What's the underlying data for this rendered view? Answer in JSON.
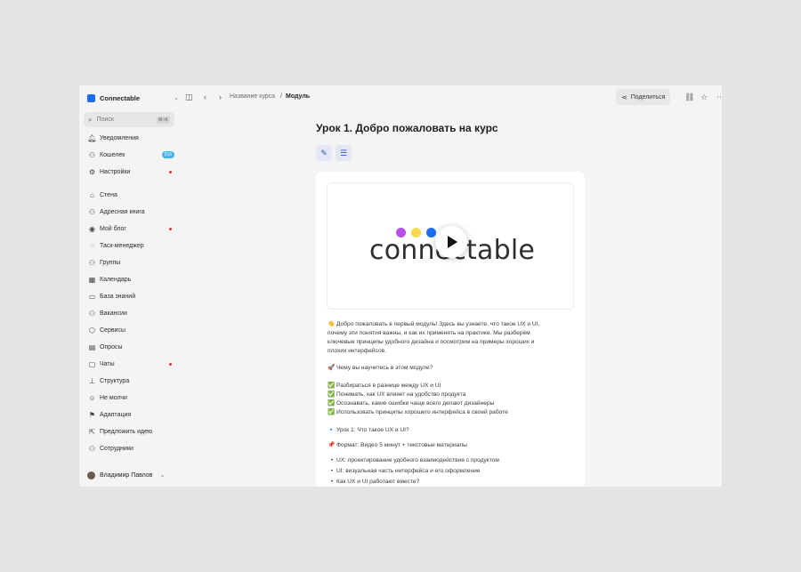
{
  "workspace": {
    "name": "Connectable"
  },
  "search": {
    "placeholder": "Поиск",
    "shortcut": "⌘+K"
  },
  "sidebar": {
    "top": [
      {
        "label": "Уведомления",
        "icon": "bell-icon"
      },
      {
        "label": "Кошелек",
        "icon": "wallet-icon",
        "badge": "516"
      },
      {
        "label": "Настройки",
        "icon": "gear-icon",
        "dot": true
      }
    ],
    "items": [
      {
        "label": "Стена",
        "icon": "home-icon"
      },
      {
        "label": "Адресная книга",
        "icon": "contacts-icon"
      },
      {
        "label": "Мой блог",
        "icon": "blog-icon",
        "dot": true
      },
      {
        "label": "Таск-менеджер",
        "icon": "check-circle-icon"
      },
      {
        "label": "Группы",
        "icon": "groups-icon"
      },
      {
        "label": "Календарь",
        "icon": "calendar-icon"
      },
      {
        "label": "База знаний",
        "icon": "folder-icon"
      },
      {
        "label": "Вакансии",
        "icon": "vacancies-icon"
      },
      {
        "label": "Сервисы",
        "icon": "services-icon"
      },
      {
        "label": "Опросы",
        "icon": "polls-icon"
      },
      {
        "label": "Чаты",
        "icon": "chat-icon",
        "dot": true
      },
      {
        "label": "Структура",
        "icon": "structure-icon"
      },
      {
        "label": "Не молчи",
        "icon": "smile-icon"
      },
      {
        "label": "Адаптация",
        "icon": "flag-icon"
      },
      {
        "label": "Предложить идею",
        "icon": "idea-icon"
      },
      {
        "label": "Сотрудники",
        "icon": "add-user-icon"
      }
    ],
    "user": {
      "name": "Владимир Павлов"
    }
  },
  "breadcrumb": {
    "course": "Название курса",
    "separator": "/",
    "current": "Модуль"
  },
  "actions": {
    "share_label": "Поделиться"
  },
  "lesson": {
    "title": "Урок 1. Добро пожаловать на курс",
    "video_logo_text": "connectable",
    "intro_lines": [
      "👋 Добро пожаловать в первый модуль! Здесь вы узнаете, что такое UX и UI,",
      "почему эти понятия важны, и как их применять на практике. Мы разберём",
      "ключевые принципы удобного дизайна и посмотрим на примеры хороших и",
      "плохих интерфейсов."
    ],
    "question": "🚀 Чему вы научитесь в этом модуле?",
    "checklist": [
      "✅ Разбираться в разнице между UX и UI",
      "✅ Понимать, как UX влияет на удобство продукта",
      "✅ Осознавать, какие ошибки чаще всего делают дизайнеры",
      "✅ Использовать принципы хорошего интерфейса в своей работе"
    ],
    "lesson1": "🔹 Урок 1: Что такое UX и UI?",
    "format": "📌 Формат: Видео 5 минут + текстовые материалы",
    "bullets": [
      "UX: проектирование удобного взаимодействия с продуктом",
      "UI: визуальная часть интерфейса и его оформление",
      "Как UX и UI работают вместе?"
    ]
  },
  "colors": {
    "accent": "#1f6cf0",
    "badge": "#3fb6e8",
    "dot": "#e5332a",
    "logo_dots": [
      "#b44fe8",
      "#f5d94a",
      "#1f6cf0"
    ]
  }
}
